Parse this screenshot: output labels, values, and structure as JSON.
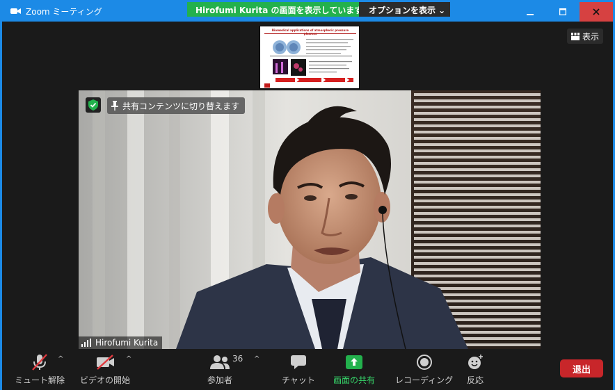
{
  "window": {
    "title": "Zoom ミーティング",
    "accent": "#1c8ae6",
    "close_color": "#d64141"
  },
  "share_banner": {
    "message": "Hirofumi  Kurita  の画面を表示しています",
    "options_label": "オプションを表示 ⌄",
    "banner_color": "#23b14d"
  },
  "view_button": {
    "label": "表示"
  },
  "shared_content": {
    "slide_title": "Biomedical applications of atmospheric pressure plasmas"
  },
  "video": {
    "switch_label": "共有コンテンツに切り替えます",
    "participant_name": "Hirofumi Kurita"
  },
  "toolbar": {
    "mute_label": "ミュート解除",
    "video_label": "ビデオの開始",
    "participants_label": "参加者",
    "participants_count": "36",
    "chat_label": "チャット",
    "share_label": "画面の共有",
    "record_label": "レコーディング",
    "reactions_label": "反応",
    "leave_label": "退出",
    "leave_color": "#c8262a",
    "share_color": "#23b14d"
  }
}
